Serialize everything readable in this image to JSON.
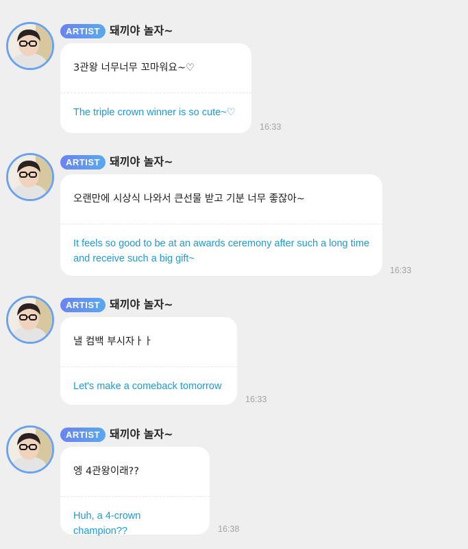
{
  "messages": [
    {
      "badge": "ARTIST",
      "sender": "돼끼야 놀자~",
      "original": "3관왕 너무너무 꼬마워요~♡",
      "translation": "The triple crown winner is so cute~♡",
      "time": "16:33"
    },
    {
      "badge": "ARTIST",
      "sender": "돼끼야 놀자~",
      "original": "오랜만에 시상식 나와서 큰선물 받고 기분 너무 좋잖아~",
      "translation": "It feels so good to be at an awards ceremony after such a long time and receive such a big gift~",
      "time": "16:33"
    },
    {
      "badge": "ARTIST",
      "sender": "돼끼야 놀자~",
      "original": "낼 컴백 부시자ㅏㅏ",
      "translation": "Let's make a comeback tomorrow",
      "time": "16:33"
    },
    {
      "badge": "ARTIST",
      "sender": "돼끼야 놀자~",
      "original": "엥 4관왕이래??",
      "translation": "Huh, a 4-crown champion??",
      "time": "16:38"
    }
  ],
  "colors": {
    "background": "#efefef",
    "badge_start": "#6a83f0",
    "badge_end": "#5aa8ee",
    "translation_text": "#1b9ad6",
    "avatar_ring": "#6aa2f0"
  }
}
